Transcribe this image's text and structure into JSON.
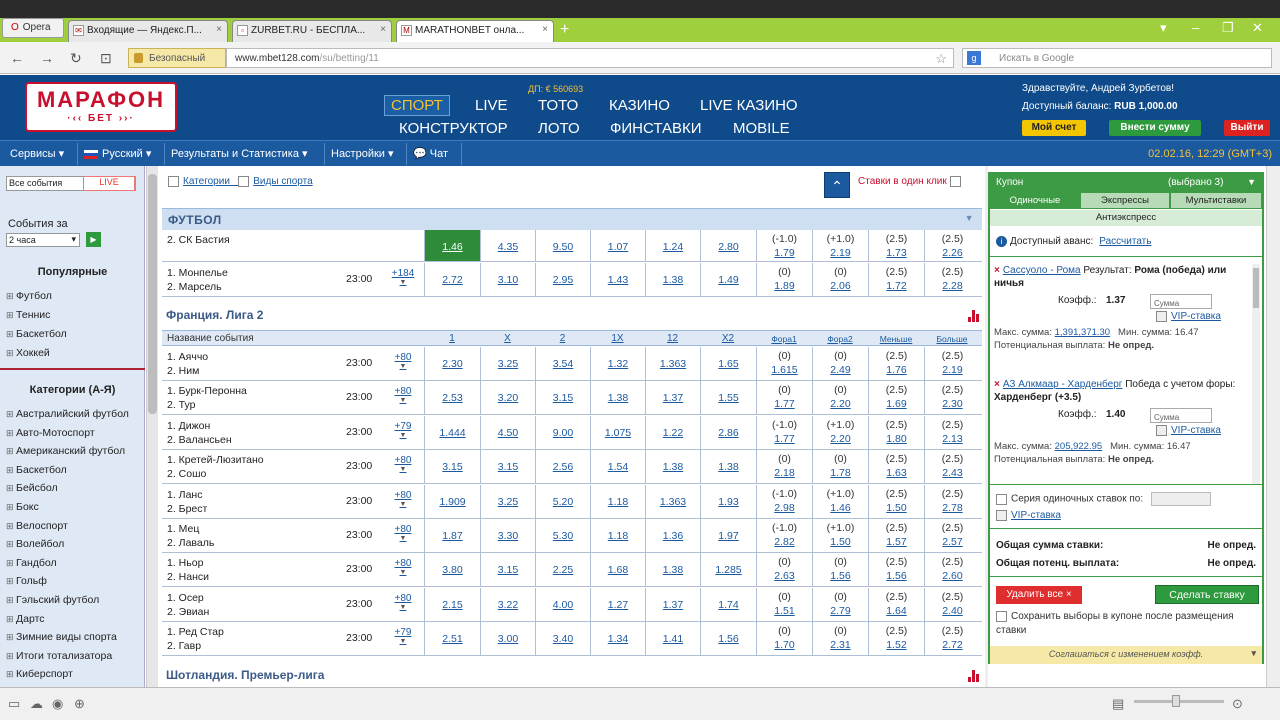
{
  "browser": {
    "opera_label": "Opera",
    "tabs": [
      {
        "title": "Входящие — Яндекс.П...",
        "favicon": "mail-icon"
      },
      {
        "title": "ZURBET.RU - БЕСПЛА...",
        "favicon": "page-icon"
      },
      {
        "title": "MARATHONBET онла...",
        "favicon": "marathon-icon"
      }
    ],
    "secure_label": "Безопасный",
    "url_host": "www.mbet128.com",
    "url_path": "/su/betting/11",
    "search_placeholder": "Искать в Google",
    "search_engine_icon": "google-icon"
  },
  "header": {
    "logo_main": "МАРАФОН",
    "logo_sub": "·‹‹ БЕТ ››·",
    "dp": "ДП: € 560693",
    "nav": [
      "СПОРТ",
      "LIVE",
      "ТОТО",
      "КАЗИНО",
      "LIVE КАЗИНО",
      "КОНСТРУКТОР",
      "ЛОТО",
      "ФИНСТАВКИ",
      "MOBILE"
    ],
    "greeting": "Здравствуйте, Андрей Зурбетов!",
    "balance_label": "Доступный баланс:",
    "balance_value": "RUB 1,000.00",
    "btn_account": "Мой счет",
    "btn_deposit": "Внести сумму",
    "btn_logout": "Выйти"
  },
  "menubar": {
    "items": [
      "Сервисы ▾",
      "Русский ▾",
      "Результаты и Статистика ▾",
      "Настройки ▾",
      "Чат"
    ],
    "datetime": "02.02.16, 12:29 (GMT+3)"
  },
  "sidebar": {
    "select_all": "Все события",
    "live": "LIVE",
    "events_for": "События за",
    "period": "2 часа",
    "popular_title": "Популярные",
    "popular": [
      "Футбол",
      "Теннис",
      "Баскетбол",
      "Хоккей"
    ],
    "categories_title": "Категории (А-Я)",
    "categories": [
      "Австралийский футбол",
      "Авто-Мотоспорт",
      "Американский футбол",
      "Баскетбол",
      "Бейсбол",
      "Бокс",
      "Велоспорт",
      "Волейбол",
      "Гандбол",
      "Гольф",
      "Гэльский футбол",
      "Дартс",
      "Зимние виды спорта",
      "Итоги тотализатора",
      "Киберспорт"
    ]
  },
  "main": {
    "filter_categories": "Категории",
    "filter_sports": "Виды спорта",
    "one_click": "Ставки в один клик",
    "sport_title": "ФУТБОЛ",
    "top_events": [
      {
        "t1": "2. СК Бастия",
        "t2": "",
        "time": "",
        "more": "",
        "odds": [
          "1.46",
          "4.35",
          "9.50",
          "1.07",
          "1.24",
          "2.80"
        ],
        "h": [
          [
            "(-1.0)",
            "1.79"
          ],
          [
            "(+1.0)",
            "2.19"
          ],
          [
            "(2.5)",
            "1.73"
          ],
          [
            "(2.5)",
            "2.26"
          ]
        ],
        "hot": 0
      },
      {
        "t1": "1. Монпелье",
        "t2": "2. Марсель",
        "time": "23:00",
        "more": "+184",
        "odds": [
          "2.72",
          "3.10",
          "2.95",
          "1.43",
          "1.38",
          "1.49"
        ],
        "h": [
          [
            "(0)",
            "1.89"
          ],
          [
            "(0)",
            "2.06"
          ],
          [
            "(2.5)",
            "1.72"
          ],
          [
            "(2.5)",
            "2.28"
          ]
        ],
        "hot": -1
      }
    ],
    "league_title": "Франция. Лига 2",
    "columns": {
      "name": "Название события",
      "c": [
        "1",
        "X",
        "2",
        "1X",
        "12",
        "X2",
        "Фора1",
        "Фора2",
        "Меньше",
        "Больше"
      ]
    },
    "events": [
      {
        "t1": "1. Аяччо",
        "t2": "2. Ним",
        "time": "23:00",
        "more": "+80",
        "odds": [
          "2.30",
          "3.25",
          "3.54",
          "1.32",
          "1.363",
          "1.65"
        ],
        "h": [
          [
            "(0)",
            "1.615"
          ],
          [
            "(0)",
            "2.49"
          ],
          [
            "(2.5)",
            "1.76"
          ],
          [
            "(2.5)",
            "2.19"
          ]
        ]
      },
      {
        "t1": "1. Бурк-Перонна",
        "t2": "2. Тур",
        "time": "23:00",
        "more": "+80",
        "odds": [
          "2.53",
          "3.20",
          "3.15",
          "1.38",
          "1.37",
          "1.55"
        ],
        "h": [
          [
            "(0)",
            "1.77"
          ],
          [
            "(0)",
            "2.20"
          ],
          [
            "(2.5)",
            "1.69"
          ],
          [
            "(2.5)",
            "2.30"
          ]
        ]
      },
      {
        "t1": "1. Дижон",
        "t2": "2. Валансьен",
        "time": "23:00",
        "more": "+79",
        "odds": [
          "1.444",
          "4.50",
          "9.00",
          "1.075",
          "1.22",
          "2.86"
        ],
        "h": [
          [
            "(-1.0)",
            "1.77"
          ],
          [
            "(+1.0)",
            "2.20"
          ],
          [
            "(2.5)",
            "1.80"
          ],
          [
            "(2.5)",
            "2.13"
          ]
        ]
      },
      {
        "t1": "1. Кретей-Люзитано",
        "t2": "2. Сошо",
        "time": "23:00",
        "more": "+80",
        "odds": [
          "3.15",
          "3.15",
          "2.56",
          "1.54",
          "1.38",
          "1.38"
        ],
        "h": [
          [
            "(0)",
            "2.18"
          ],
          [
            "(0)",
            "1.78"
          ],
          [
            "(2.5)",
            "1.63"
          ],
          [
            "(2.5)",
            "2.43"
          ]
        ]
      },
      {
        "t1": "1. Ланс",
        "t2": "2. Брест",
        "time": "23:00",
        "more": "+80",
        "odds": [
          "1.909",
          "3.25",
          "5.20",
          "1.18",
          "1.363",
          "1.93"
        ],
        "h": [
          [
            "(-1.0)",
            "2.98"
          ],
          [
            "(+1.0)",
            "1.46"
          ],
          [
            "(2.5)",
            "1.50"
          ],
          [
            "(2.5)",
            "2.78"
          ]
        ]
      },
      {
        "t1": "1. Мец",
        "t2": "2. Лаваль",
        "time": "23:00",
        "more": "+80",
        "odds": [
          "1.87",
          "3.30",
          "5.30",
          "1.18",
          "1.36",
          "1.97"
        ],
        "h": [
          [
            "(-1.0)",
            "2.82"
          ],
          [
            "(+1.0)",
            "1.50"
          ],
          [
            "(2.5)",
            "1.57"
          ],
          [
            "(2.5)",
            "2.57"
          ]
        ]
      },
      {
        "t1": "1. Ньор",
        "t2": "2. Нанси",
        "time": "23:00",
        "more": "+80",
        "odds": [
          "3.80",
          "3.15",
          "2.25",
          "1.68",
          "1.38",
          "1.285"
        ],
        "h": [
          [
            "(0)",
            "2.63"
          ],
          [
            "(0)",
            "1.56"
          ],
          [
            "(2.5)",
            "1.56"
          ],
          [
            "(2.5)",
            "2.60"
          ]
        ]
      },
      {
        "t1": "1. Осер",
        "t2": "2. Эвиан",
        "time": "23:00",
        "more": "+80",
        "odds": [
          "2.15",
          "3.22",
          "4.00",
          "1.27",
          "1.37",
          "1.74"
        ],
        "h": [
          [
            "(0)",
            "1.51"
          ],
          [
            "(0)",
            "2.79"
          ],
          [
            "(2.5)",
            "1.64"
          ],
          [
            "(2.5)",
            "2.40"
          ]
        ]
      },
      {
        "t1": "1. Ред Стар",
        "t2": "2. Гавр",
        "time": "23:00",
        "more": "+79",
        "odds": [
          "2.51",
          "3.00",
          "3.40",
          "1.34",
          "1.41",
          "1.56"
        ],
        "h": [
          [
            "(0)",
            "1.70"
          ],
          [
            "(0)",
            "2.31"
          ],
          [
            "(2.5)",
            "1.52"
          ],
          [
            "(2.5)",
            "2.72"
          ]
        ]
      }
    ],
    "next_league": "Шотландия. Премьер-лига"
  },
  "coupon": {
    "title": "Купон",
    "count": "(выбрано 3)",
    "tabs": [
      "Одиночные",
      "Экспрессы",
      "Мультиставки"
    ],
    "antiexpress": "Антиэкспресс",
    "avans_label": "Доступный аванс:",
    "avans_link": "Рассчитать",
    "bets": [
      {
        "match": "Сассуоло - Рома",
        "result": "Результат:",
        "pick": "Рома (победа) или ничья",
        "coef_label": "Коэфф.:",
        "coef": "1.37",
        "sum_ph": "Сумма",
        "vip": "VIP-ставка",
        "max_label": "Макс. сумма:",
        "max": "1,391,371.30",
        "min_label": "Мин. сумма:",
        "min": "16.47",
        "payout_label": "Потенциальная выплата:",
        "payout": "Не опред."
      },
      {
        "match": "АЗ Алкмаар - Харденберг",
        "result": "Победа с учетом форы:",
        "pick": "Харденберг (+3.5)",
        "coef_label": "Коэфф.:",
        "coef": "1.40",
        "sum_ph": "Сумма",
        "vip": "VIP-ставка",
        "max_label": "Макс. сумма:",
        "max": "205,922.95",
        "min_label": "Мин. сумма:",
        "min": "16.47",
        "payout_label": "Потенциальная выплата:",
        "payout": "Не опред."
      }
    ],
    "series_label": "Серия одиночных ставок по:",
    "series_vip": "VIP-ставка",
    "total_label": "Общая сумма ставки:",
    "total_value": "Не опред.",
    "total_payout_label": "Общая потенц. выплата:",
    "total_payout_value": "Не опред.",
    "delete_all": "Удалить все ×",
    "place_bet": "Сделать ставку",
    "save_choice": "Сохранить выборы в купоне после размещения ставки",
    "agree": "Соглашаться с изменением коэфф.",
    "agree_dd": "▾"
  },
  "colors": {
    "brand_blue": "#0f4a8a",
    "brand_red": "#c8102e",
    "coupon_green": "#3d9a45",
    "hot_cell": "#2e8b3a"
  }
}
